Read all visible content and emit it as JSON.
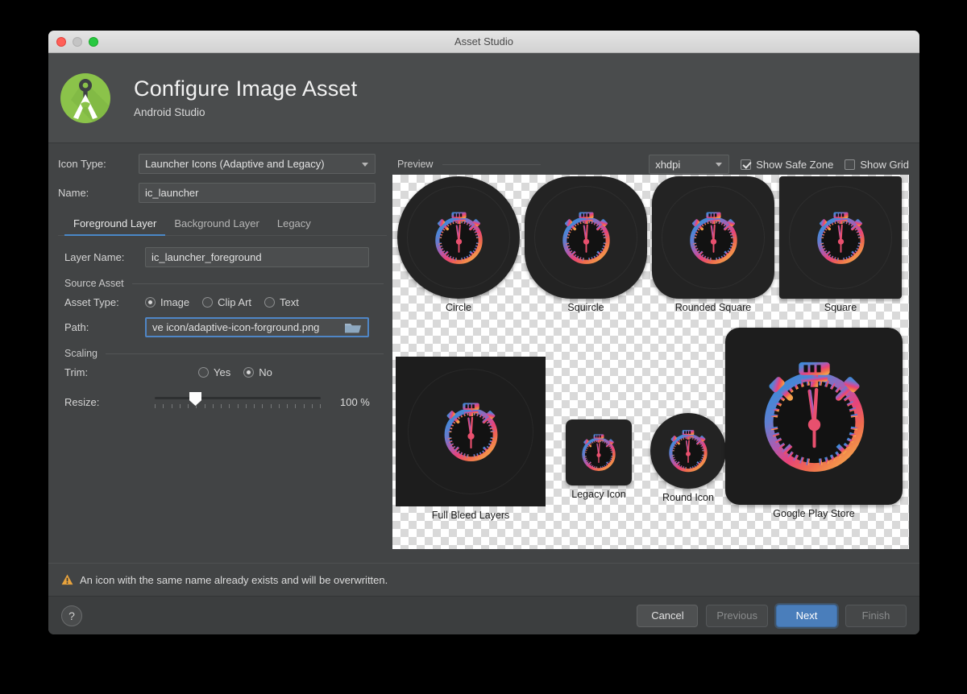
{
  "window": {
    "title": "Asset Studio",
    "traffic_lights": [
      "close",
      "minimize",
      "zoom"
    ]
  },
  "header": {
    "title": "Configure Image Asset",
    "subtitle": "Android Studio",
    "logo_icon": "android-studio-logo"
  },
  "form": {
    "icon_type_label": "Icon Type:",
    "icon_type_value": "Launcher Icons (Adaptive and Legacy)",
    "name_label": "Name:",
    "name_value": "ic_launcher",
    "tabs": [
      {
        "label": "Foreground Layer",
        "active": true
      },
      {
        "label": "Background Layer",
        "active": false
      },
      {
        "label": "Legacy",
        "active": false
      }
    ],
    "layer_name_label": "Layer Name:",
    "layer_name_value": "ic_launcher_foreground",
    "source_asset_section": "Source Asset",
    "asset_type_label": "Asset Type:",
    "asset_type_options": [
      {
        "label": "Image",
        "selected": true
      },
      {
        "label": "Clip Art",
        "selected": false
      },
      {
        "label": "Text",
        "selected": false
      }
    ],
    "path_label": "Path:",
    "path_value": "ve icon/adaptive-icon-forground.png",
    "path_browse_icon": "folder-icon",
    "scaling_section": "Scaling",
    "trim_label": "Trim:",
    "trim_options": [
      {
        "label": "Yes",
        "selected": false
      },
      {
        "label": "No",
        "selected": true
      }
    ],
    "resize_label": "Resize:",
    "resize_value": "100 %",
    "resize_percent": 100,
    "resize_thumb_position_pct": 25,
    "slider_tick_count": 21
  },
  "preview": {
    "title": "Preview",
    "dpi_value": "xhdpi",
    "show_safe_zone": {
      "label": "Show Safe Zone",
      "checked": true
    },
    "show_grid": {
      "label": "Show Grid",
      "checked": false
    },
    "tiles": [
      {
        "label": "Circle",
        "shape": "circle"
      },
      {
        "label": "Squircle",
        "shape": "squircle"
      },
      {
        "label": "Rounded Square",
        "shape": "rounded-square"
      },
      {
        "label": "Square",
        "shape": "square"
      },
      {
        "label": "Full Bleed Layers",
        "shape": "full-bleed"
      },
      {
        "label": "Legacy Icon",
        "shape": "legacy"
      },
      {
        "label": "Round Icon",
        "shape": "round"
      },
      {
        "label": "Google Play Store",
        "shape": "play-store"
      }
    ],
    "icon_art": "stopwatch-icon"
  },
  "warning": {
    "icon": "warning-triangle-icon",
    "text": "An icon with the same name already exists and will be overwritten."
  },
  "footer": {
    "help_label": "?",
    "buttons": [
      {
        "label": "Cancel",
        "state": "enabled"
      },
      {
        "label": "Previous",
        "state": "disabled"
      },
      {
        "label": "Next",
        "state": "primary"
      },
      {
        "label": "Finish",
        "state": "disabled"
      }
    ]
  },
  "colors": {
    "dialog_bg": "#424445",
    "header_bg": "#4a4c4d",
    "accent_blue": "#4a88c7",
    "primary_button": "#4a7ebb",
    "warning_amber": "#e8a33d",
    "logo_green": "#8bc34a"
  }
}
